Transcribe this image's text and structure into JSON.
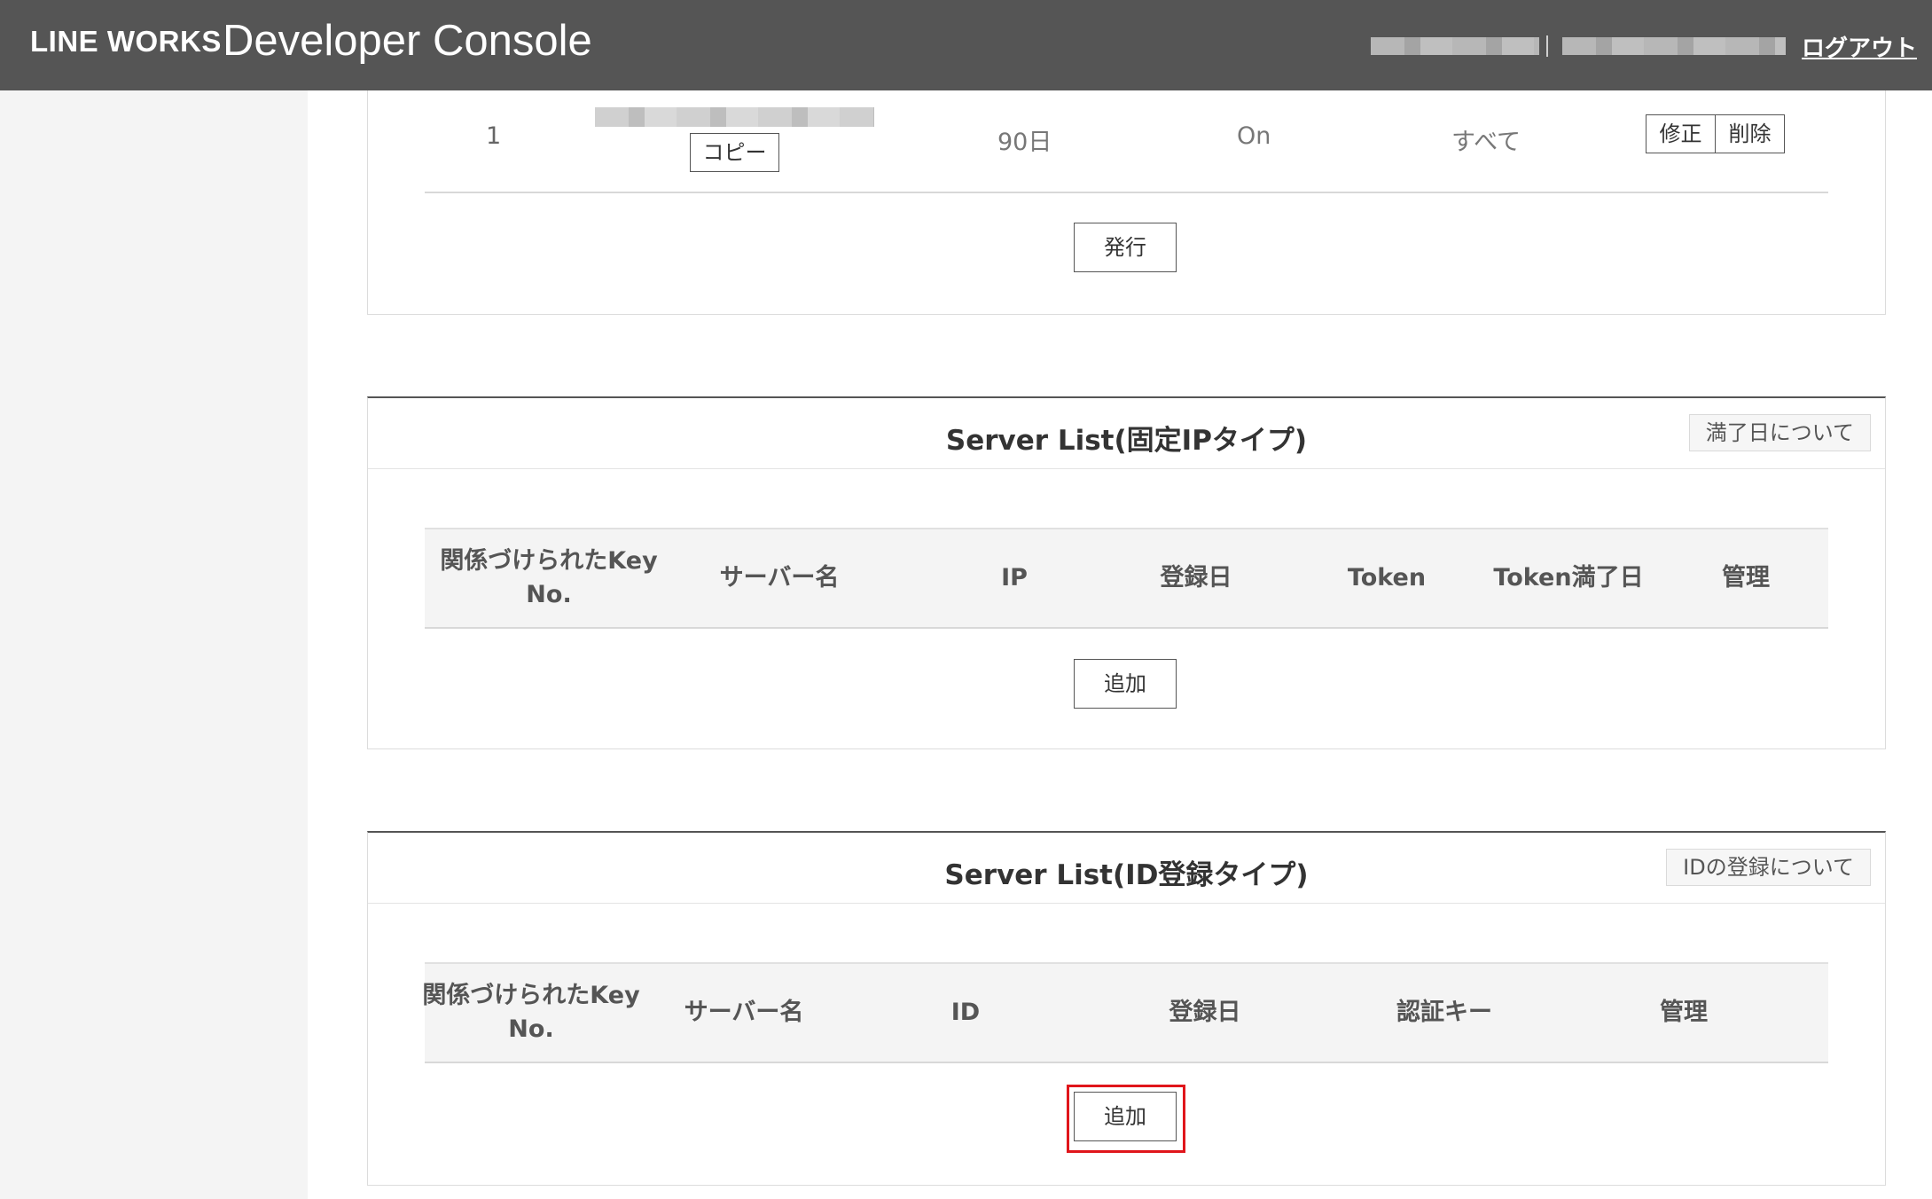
{
  "header": {
    "brand": "LINE WORKS",
    "product": "Developer Console",
    "logout_label": "ログアウト"
  },
  "api_key_panel": {
    "row": {
      "no": "1",
      "copy_label": "コピー",
      "expiry": "90日",
      "status": "On",
      "scope": "すべて",
      "edit_label": "修正",
      "delete_label": "削除"
    },
    "issue_label": "発行"
  },
  "server_list_ip": {
    "title": "Server List(固定IPタイプ)",
    "info_label": "満了日について",
    "columns": [
      "関係づけられたKey No.",
      "サーバー名",
      "IP",
      "登録日",
      "Token",
      "Token満了日",
      "管理"
    ],
    "add_label": "追加"
  },
  "server_list_id": {
    "title": "Server List(ID登録タイプ)",
    "info_label": "IDの登録について",
    "columns": [
      "関係づけられたKey No.",
      "サーバー名",
      "ID",
      "登録日",
      "認証キー",
      "管理"
    ],
    "add_label": "追加"
  },
  "highlight_color": "#e0151b"
}
